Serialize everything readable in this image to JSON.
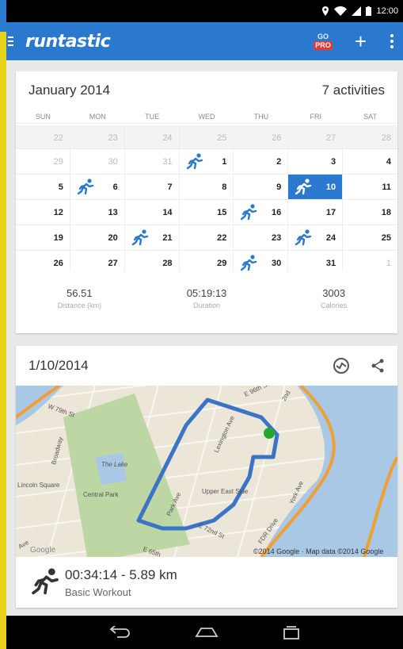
{
  "statusbar": {
    "time": "12:00"
  },
  "appbar": {
    "logo": "runtastic",
    "go_label": "GO",
    "pro_label": "PRO",
    "add_label": "+"
  },
  "calendar": {
    "month": "January 2014",
    "activities": "7 activities",
    "weekdays": [
      "SUN",
      "MON",
      "TUE",
      "WED",
      "THU",
      "FRI",
      "SAT"
    ],
    "weeks": [
      [
        "22",
        "23",
        "24",
        "25",
        "26",
        "27",
        "28"
      ],
      [
        "29",
        "30",
        "31",
        "1",
        "2",
        "3",
        "4"
      ],
      [
        "5",
        "6",
        "7",
        "8",
        "9",
        "10",
        "11"
      ],
      [
        "12",
        "13",
        "14",
        "15",
        "16",
        "17",
        "18"
      ],
      [
        "19",
        "20",
        "21",
        "22",
        "23",
        "24",
        "25"
      ],
      [
        "26",
        "27",
        "28",
        "29",
        "30",
        "31",
        "1"
      ]
    ],
    "selected_day": "10"
  },
  "stats": {
    "distance_value": "56.51",
    "distance_label": "Distance (km)",
    "duration_value": "05:19:13",
    "duration_label": "Duration",
    "calories_value": "3003",
    "calories_label": "Calories"
  },
  "activity": {
    "date": "1/10/2014",
    "summary": "00:34:14 - 5.89 km",
    "type": "Basic Workout"
  },
  "map": {
    "labels": {
      "w79": "W 79th St",
      "e96": "E 96th St",
      "second": "2nd",
      "lex": "Lexington Ave",
      "york": "York Ave",
      "park": "Park Ave",
      "ues": "Upper East Side",
      "lake": "The Lake",
      "cpark": "Central Park",
      "lincoln": "Lincoln Square",
      "broadway": "Broadway",
      "e65": "E 65th",
      "e72": "E 72nd St",
      "fdr": "FDR Drive",
      "ave": "Ave",
      "google": "Google",
      "attribution": "©2014 Google · Map data ©2014 Google"
    }
  },
  "colors": {
    "primary": "#2b78cf",
    "pro_badge": "#e53935",
    "route": "#3b74c7",
    "marker": "#22a830"
  }
}
